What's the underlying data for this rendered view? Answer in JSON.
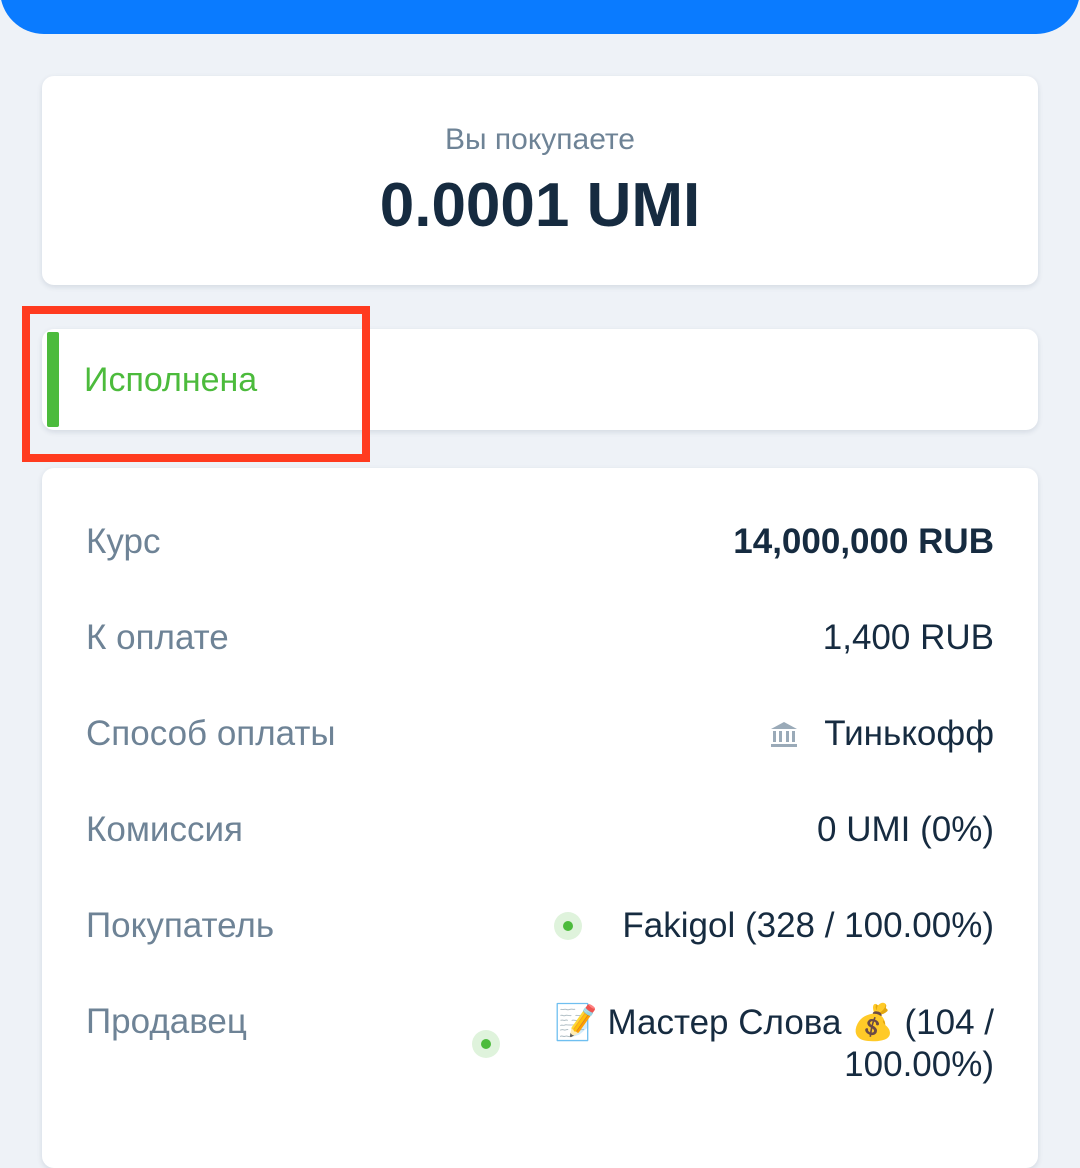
{
  "buy": {
    "label": "Вы покупаете",
    "amount": "0.0001 UMI"
  },
  "status": {
    "text": "Исполнена",
    "color": "#4cbb3c"
  },
  "details": {
    "rate": {
      "label": "Курс",
      "value": "14,000,000 RUB"
    },
    "to_pay": {
      "label": "К оплате",
      "value": "1,400 RUB"
    },
    "payment_method": {
      "label": "Способ оплаты",
      "value": "Тинькофф",
      "icon": "bank-icon"
    },
    "commission": {
      "label": "Комиссия",
      "value": "0 UMI (0%)"
    },
    "buyer": {
      "label": "Покупатель",
      "value": "Fakigol (328 / 100.00%)",
      "online": true
    },
    "seller": {
      "label": "Продавец",
      "value_line1": "📝 Мастер Слова 💰 (104 /",
      "value_line2": "100.00%)",
      "online": true
    }
  },
  "colors": {
    "accent": "#0a7bff",
    "highlight": "#ff3b1f",
    "success": "#4cbb3c",
    "text_dark": "#162b40",
    "text_muted": "#6e8396"
  }
}
